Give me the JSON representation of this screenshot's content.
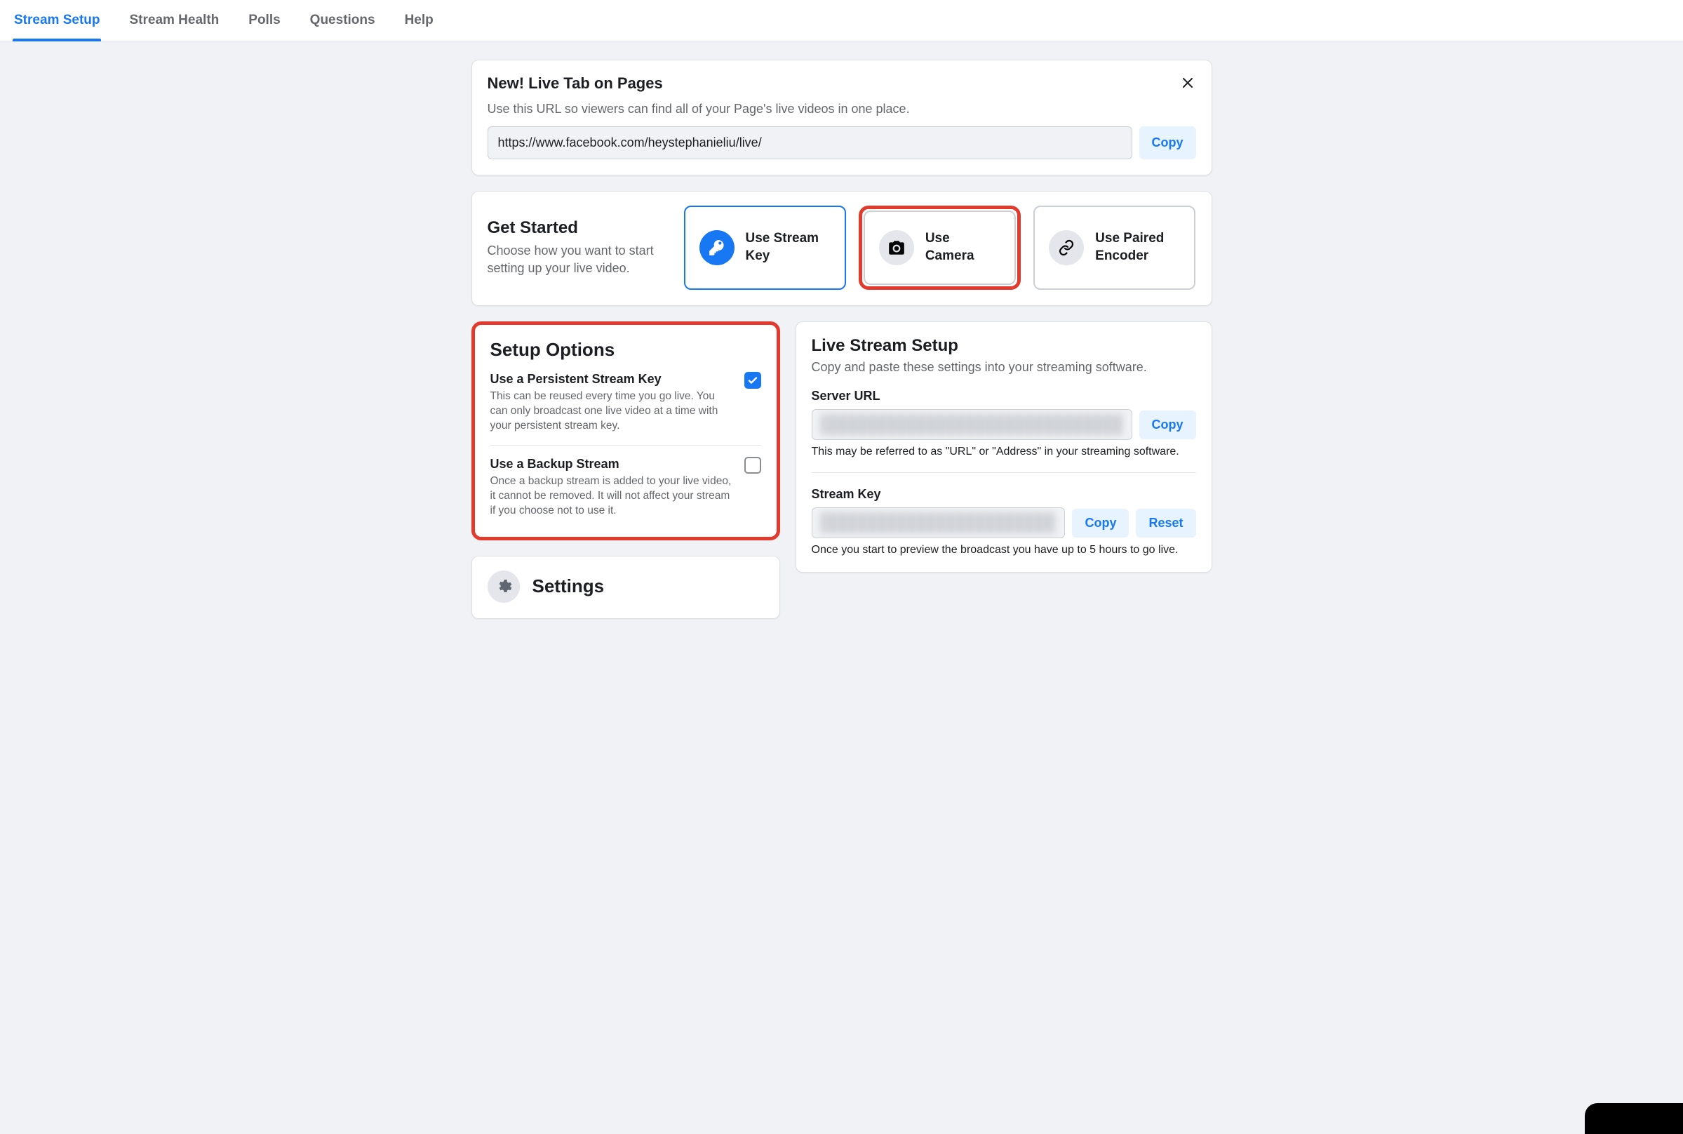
{
  "tabs": [
    {
      "label": "Stream Setup",
      "active": true
    },
    {
      "label": "Stream Health"
    },
    {
      "label": "Polls"
    },
    {
      "label": "Questions"
    },
    {
      "label": "Help"
    }
  ],
  "banner": {
    "title": "New! Live Tab on Pages",
    "subtitle": "Use this URL so viewers can find all of your Page's live videos in one place.",
    "url": "https://www.facebook.com/heystephanieliu/live/",
    "copy_label": "Copy"
  },
  "get_started": {
    "title": "Get Started",
    "subtitle": "Choose how you want to start setting up your live video.",
    "options": [
      {
        "label": "Use Stream Key",
        "selected": true,
        "icon": "key"
      },
      {
        "label": "Use Camera",
        "highlighted": true,
        "icon": "camera"
      },
      {
        "label": "Use Paired Encoder",
        "icon": "link"
      }
    ]
  },
  "setup_options": {
    "title": "Setup Options",
    "items": [
      {
        "title": "Use a Persistent Stream Key",
        "desc": "This can be reused every time you go live. You can only broadcast one live video at a time with your persistent stream key.",
        "checked": true
      },
      {
        "title": "Use a Backup Stream",
        "desc": "Once a backup stream is added to your live video, it cannot be removed. It will not affect your stream if you choose not to use it.",
        "checked": false
      }
    ]
  },
  "settings": {
    "title": "Settings"
  },
  "live_stream": {
    "title": "Live Stream Setup",
    "subtitle": "Copy and paste these settings into your streaming software.",
    "server_url_label": "Server URL",
    "server_url_hint": "This may be referred to as \"URL\" or \"Address\" in your streaming software.",
    "stream_key_label": "Stream Key",
    "stream_key_hint": "Once you start to preview the broadcast you have up to 5 hours to go live.",
    "copy_label": "Copy",
    "reset_label": "Reset"
  }
}
